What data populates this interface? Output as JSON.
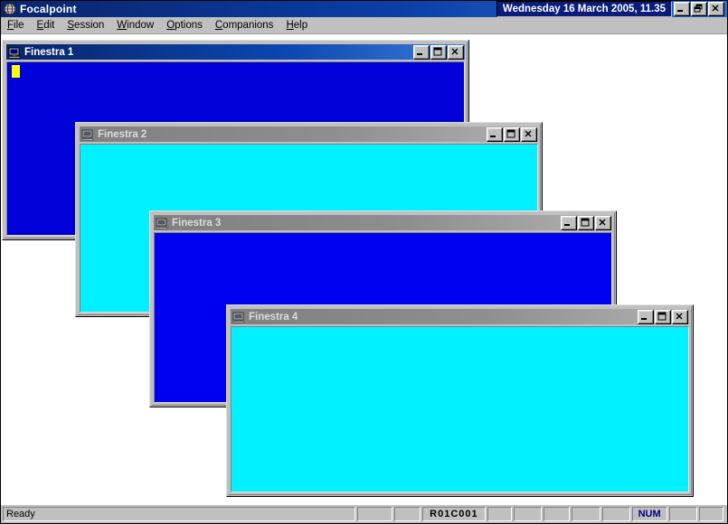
{
  "app": {
    "title": "Focalpoint",
    "icon": "app-globe-icon",
    "titlebar_color": "#0a246a",
    "date_text": "Wednesday 16 March 2005, 11.35"
  },
  "window_buttons": {
    "minimize": "minimize-icon",
    "restore": "restore-icon",
    "close": "close-icon"
  },
  "menu": {
    "items": [
      {
        "pre": "",
        "hotkey": "F",
        "post": "ile"
      },
      {
        "pre": "",
        "hotkey": "E",
        "post": "dit"
      },
      {
        "pre": "",
        "hotkey": "S",
        "post": "ession"
      },
      {
        "pre": "",
        "hotkey": "W",
        "post": "indow"
      },
      {
        "pre": "",
        "hotkey": "O",
        "post": "ptions"
      },
      {
        "pre": "",
        "hotkey": "C",
        "post": "ompanions"
      },
      {
        "pre": "",
        "hotkey": "H",
        "post": "elp"
      }
    ]
  },
  "children": [
    {
      "title": "Finestra 1",
      "icon": "terminal-session-icon",
      "state": "active",
      "screen_color": "#0000d8",
      "has_cursor": true
    },
    {
      "title": "Finestra 2",
      "icon": "terminal-session-icon",
      "state": "inactive",
      "screen_color": "#00f0ff",
      "has_cursor": false
    },
    {
      "title": "Finestra 3",
      "icon": "terminal-session-icon",
      "state": "inactive",
      "screen_color": "#0000f0",
      "has_cursor": false
    },
    {
      "title": "Finestra 4",
      "icon": "terminal-session-icon",
      "state": "inactive",
      "screen_color": "#00f0ff",
      "has_cursor": false
    }
  ],
  "statusbar": {
    "message": "Ready",
    "panels": [
      {
        "text": "",
        "style": "plain"
      },
      {
        "text": "",
        "style": "plain"
      },
      {
        "text": "R01C001",
        "style": "bold"
      },
      {
        "text": "",
        "style": "plain"
      },
      {
        "text": "",
        "style": "plain"
      },
      {
        "text": "",
        "style": "plain"
      },
      {
        "text": "",
        "style": "plain"
      },
      {
        "text": "",
        "style": "plain"
      },
      {
        "text": "NUM",
        "style": "blue"
      },
      {
        "text": "",
        "style": "plain"
      },
      {
        "text": "",
        "style": "plain"
      }
    ]
  }
}
